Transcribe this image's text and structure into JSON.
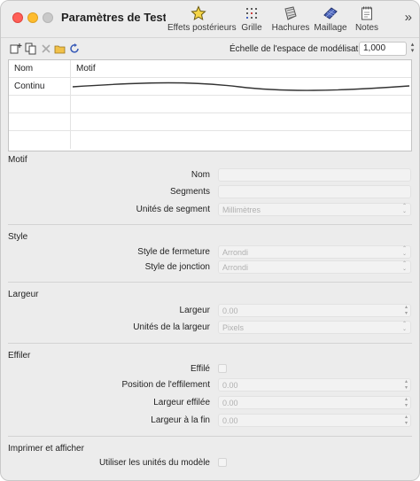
{
  "window": {
    "title": "Paramètres de Test..."
  },
  "toolbar": {
    "items": [
      {
        "label": "Effets postérieurs",
        "icon": "star-icon"
      },
      {
        "label": "Grille",
        "icon": "grid-icon"
      },
      {
        "label": "Hachures",
        "icon": "hatch-icon"
      },
      {
        "label": "Maillage",
        "icon": "mesh-icon"
      },
      {
        "label": "Notes",
        "icon": "notes-icon"
      }
    ],
    "overflow": "»"
  },
  "subtoolbar": {
    "scale_label": "Échelle de l'espace de modélisation",
    "scale_value": "1,000"
  },
  "table": {
    "headers": [
      "Nom",
      "Motif"
    ],
    "rows": [
      {
        "name": "Continu"
      }
    ]
  },
  "sections": {
    "motif": {
      "title": "Motif",
      "nom_label": "Nom",
      "segments_label": "Segments",
      "unites_segment_label": "Unités de segment",
      "unites_segment_value": "Millimètres"
    },
    "style": {
      "title": "Style",
      "fermeture_label": "Style de fermeture",
      "fermeture_value": "Arrondi",
      "jonction_label": "Style de jonction",
      "jonction_value": "Arrondi"
    },
    "largeur": {
      "title": "Largeur",
      "largeur_label": "Largeur",
      "largeur_value": "0.00",
      "unites_label": "Unités de la largeur",
      "unites_value": "Pixels"
    },
    "effiler": {
      "title": "Effiler",
      "effile_label": "Effilé",
      "position_label": "Position de l'effilement",
      "position_value": "0.00",
      "largeur_effilee_label": "Largeur effilée",
      "largeur_effilee_value": "0.00",
      "largeur_fin_label": "Largeur à la fin",
      "largeur_fin_value": "0.00"
    },
    "imprimer": {
      "title": "Imprimer et afficher",
      "utiliser_label": "Utiliser les unités du modèle"
    }
  }
}
